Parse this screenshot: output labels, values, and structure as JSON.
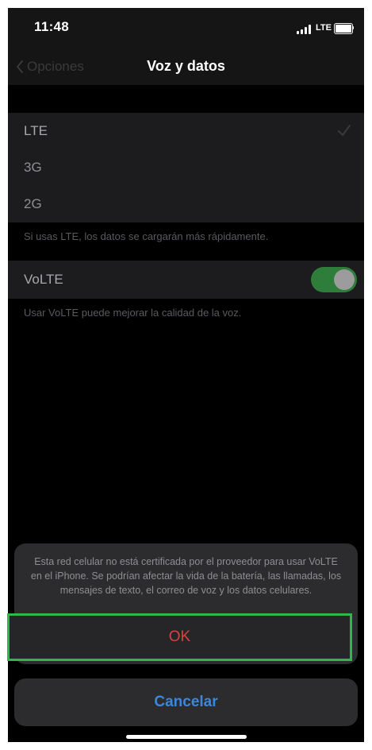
{
  "status_bar": {
    "time": "11:48",
    "network": "LTE"
  },
  "nav": {
    "back_label": "Opciones",
    "title": "Voz y datos"
  },
  "network_options": {
    "items": [
      {
        "label": "LTE",
        "selected": true
      },
      {
        "label": "3G",
        "selected": false
      },
      {
        "label": "2G",
        "selected": false
      }
    ],
    "footer": "Si usas LTE, los datos se cargarán más rápidamente."
  },
  "volte": {
    "label": "VoLTE",
    "enabled": true,
    "footer": "Usar VoLTE puede mejorar la calidad de la voz."
  },
  "alert": {
    "message": "Esta red celular no está certificada por el proveedor para usar VoLTE en el iPhone. Se podrían afectar la vida de la batería, las llamadas, los mensajes de texto, el correo de voz y los datos celulares.",
    "ok_label": "OK",
    "cancel_label": "Cancelar"
  },
  "colors": {
    "ok_text": "#d6453b",
    "cancel_text": "#3b87d9",
    "highlight_border": "#2fb84a",
    "toggle_on": "#2e7d3a"
  }
}
